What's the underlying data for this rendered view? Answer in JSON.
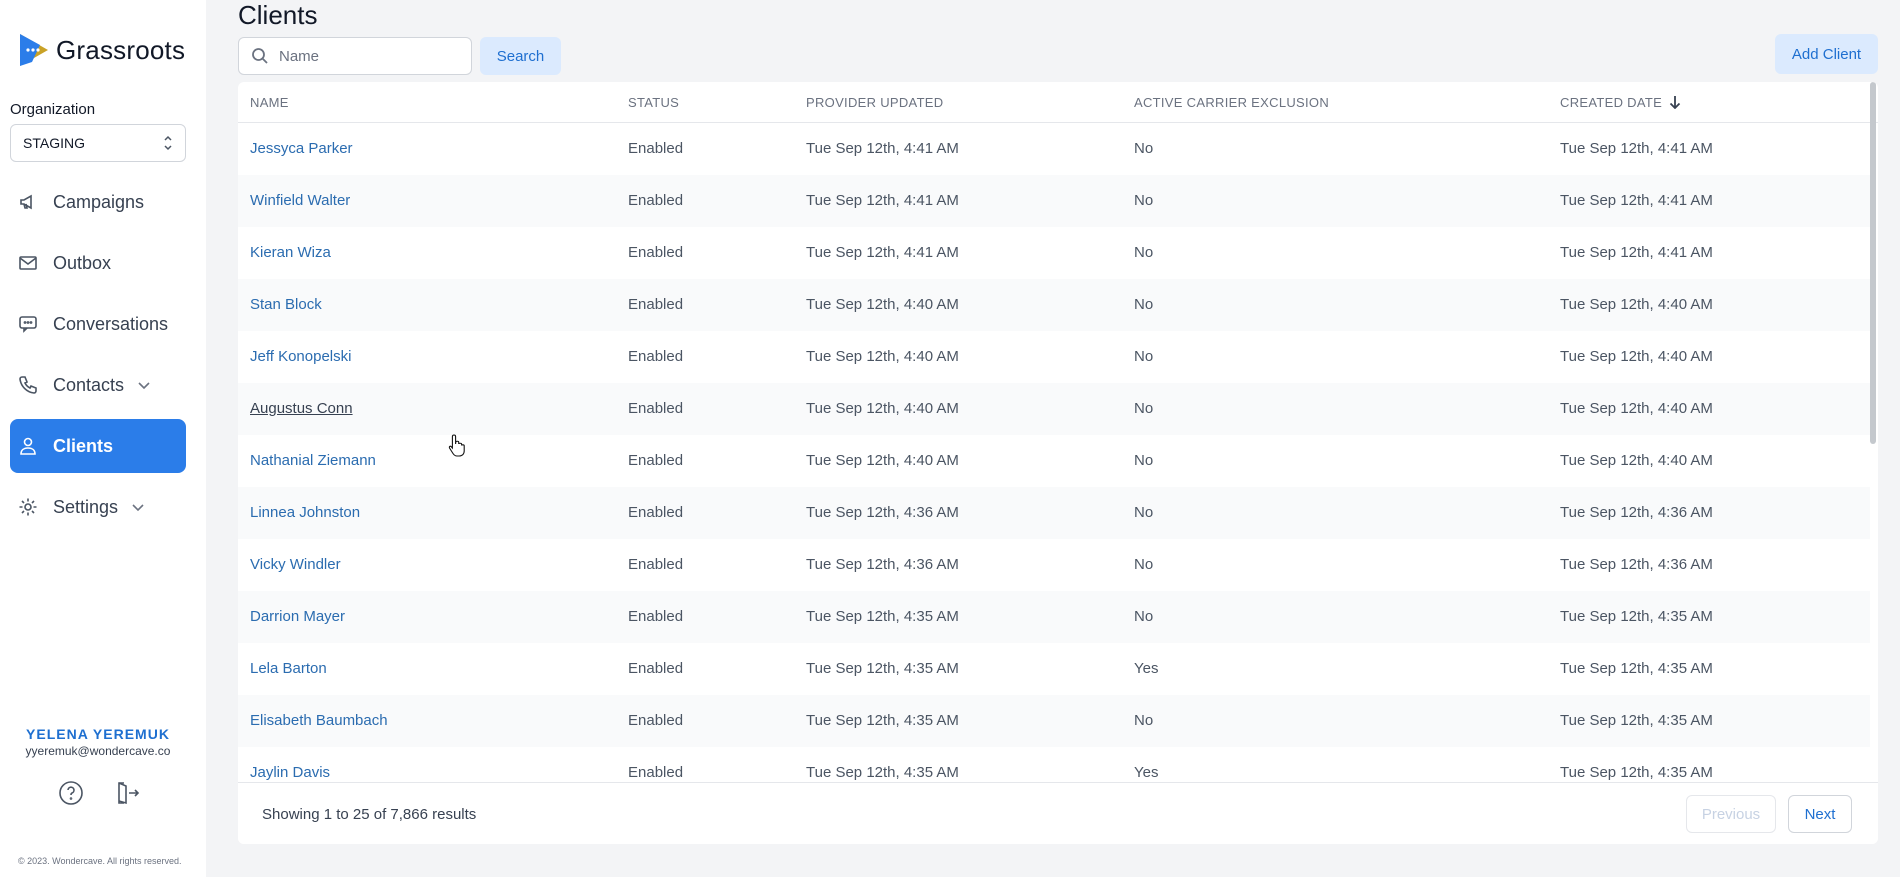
{
  "app": {
    "name": "Grassroots",
    "copyright": "© 2023. Wondercave. All rights reserved."
  },
  "organization": {
    "label": "Organization",
    "selected": "STAGING"
  },
  "nav": {
    "campaigns": "Campaigns",
    "outbox": "Outbox",
    "conversations": "Conversations",
    "contacts": "Contacts",
    "clients": "Clients",
    "settings": "Settings"
  },
  "user": {
    "name": "YELENA YEREMUK",
    "email": "yyeremuk@wondercave.co"
  },
  "page": {
    "title": "Clients",
    "search_placeholder": "Name",
    "search_label": "Search",
    "add_label": "Add Client"
  },
  "table": {
    "headers": {
      "name": "NAME",
      "status": "STATUS",
      "provider_updated": "PROVIDER UPDATED",
      "carrier_exclusion": "ACTIVE CARRIER EXCLUSION",
      "created_date": "CREATED DATE"
    },
    "sort": {
      "column": "created_date",
      "direction": "desc"
    },
    "rows": [
      {
        "name": "Jessyca Parker",
        "status": "Enabled",
        "provider_updated": "Tue Sep 12th, 4:41 AM",
        "exclusion": "No",
        "created": "Tue Sep 12th, 4:41 AM"
      },
      {
        "name": "Winfield Walter",
        "status": "Enabled",
        "provider_updated": "Tue Sep 12th, 4:41 AM",
        "exclusion": "No",
        "created": "Tue Sep 12th, 4:41 AM"
      },
      {
        "name": "Kieran Wiza",
        "status": "Enabled",
        "provider_updated": "Tue Sep 12th, 4:41 AM",
        "exclusion": "No",
        "created": "Tue Sep 12th, 4:41 AM"
      },
      {
        "name": "Stan Block",
        "status": "Enabled",
        "provider_updated": "Tue Sep 12th, 4:40 AM",
        "exclusion": "No",
        "created": "Tue Sep 12th, 4:40 AM"
      },
      {
        "name": "Jeff Konopelski",
        "status": "Enabled",
        "provider_updated": "Tue Sep 12th, 4:40 AM",
        "exclusion": "No",
        "created": "Tue Sep 12th, 4:40 AM"
      },
      {
        "name": "Augustus Conn",
        "status": "Enabled",
        "provider_updated": "Tue Sep 12th, 4:40 AM",
        "exclusion": "No",
        "created": "Tue Sep 12th, 4:40 AM"
      },
      {
        "name": "Nathanial Ziemann",
        "status": "Enabled",
        "provider_updated": "Tue Sep 12th, 4:40 AM",
        "exclusion": "No",
        "created": "Tue Sep 12th, 4:40 AM"
      },
      {
        "name": "Linnea Johnston",
        "status": "Enabled",
        "provider_updated": "Tue Sep 12th, 4:36 AM",
        "exclusion": "No",
        "created": "Tue Sep 12th, 4:36 AM"
      },
      {
        "name": "Vicky Windler",
        "status": "Enabled",
        "provider_updated": "Tue Sep 12th, 4:36 AM",
        "exclusion": "No",
        "created": "Tue Sep 12th, 4:36 AM"
      },
      {
        "name": "Darrion Mayer",
        "status": "Enabled",
        "provider_updated": "Tue Sep 12th, 4:35 AM",
        "exclusion": "No",
        "created": "Tue Sep 12th, 4:35 AM"
      },
      {
        "name": "Lela Barton",
        "status": "Enabled",
        "provider_updated": "Tue Sep 12th, 4:35 AM",
        "exclusion": "Yes",
        "created": "Tue Sep 12th, 4:35 AM"
      },
      {
        "name": "Elisabeth Baumbach",
        "status": "Enabled",
        "provider_updated": "Tue Sep 12th, 4:35 AM",
        "exclusion": "No",
        "created": "Tue Sep 12th, 4:35 AM"
      },
      {
        "name": "Jaylin Davis",
        "status": "Enabled",
        "provider_updated": "Tue Sep 12th, 4:35 AM",
        "exclusion": "Yes",
        "created": "Tue Sep 12th, 4:35 AM"
      }
    ]
  },
  "pagination": {
    "summary": "Showing 1 to 25 of 7,866 results",
    "previous": "Previous",
    "next": "Next"
  }
}
